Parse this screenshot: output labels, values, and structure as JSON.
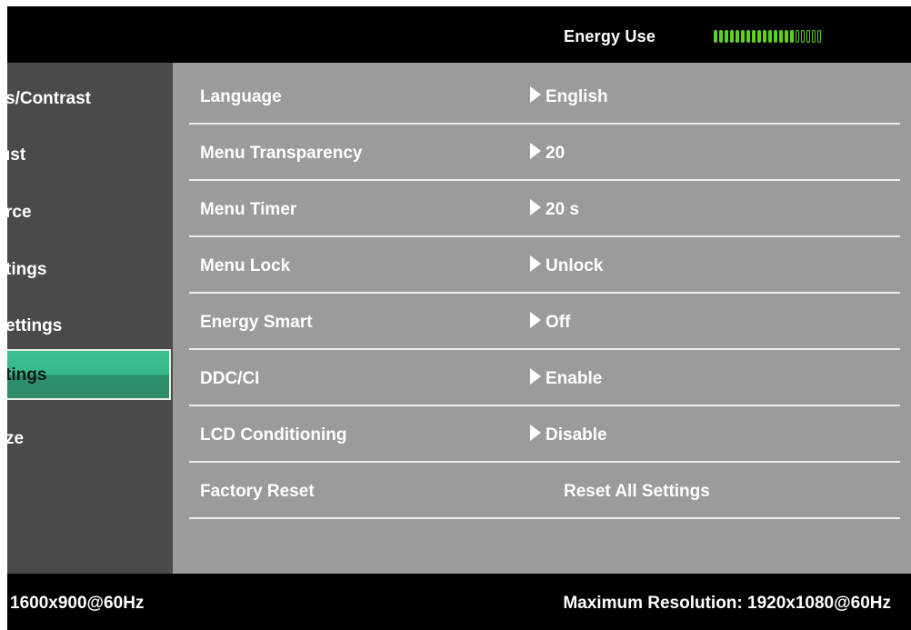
{
  "header": {
    "energy_label": "Energy Use",
    "energy_level": {
      "filled": 15,
      "total": 20
    },
    "meter_color": "#5cd11f"
  },
  "nav": {
    "items": [
      {
        "label": "s/Contrast",
        "selected": false
      },
      {
        "label": "ıst",
        "selected": false
      },
      {
        "label": "rce",
        "selected": false
      },
      {
        "label": "tings",
        "selected": false
      },
      {
        "label": "ettings",
        "selected": false
      },
      {
        "label": "tings",
        "selected": true
      },
      {
        "label": "ze",
        "selected": false
      }
    ],
    "selected_color": "#3dc08f"
  },
  "settings": {
    "rows": [
      {
        "label": "Language",
        "value": "English",
        "arrow": true
      },
      {
        "label": "Menu Transparency",
        "value": "20",
        "arrow": true
      },
      {
        "label": "Menu Timer",
        "value": "20 s",
        "arrow": true
      },
      {
        "label": "Menu Lock",
        "value": "Unlock",
        "arrow": true
      },
      {
        "label": "Energy Smart",
        "value": "Off",
        "arrow": true
      },
      {
        "label": "DDC/CI",
        "value": "Enable",
        "arrow": true
      },
      {
        "label": "LCD Conditioning",
        "value": "Disable",
        "arrow": true
      },
      {
        "label": "Factory Reset",
        "value": "Reset All Settings",
        "arrow": false
      }
    ]
  },
  "footer": {
    "current_resolution": "1600x900@60Hz",
    "max_resolution": "Maximum Resolution: 1920x1080@60Hz"
  }
}
